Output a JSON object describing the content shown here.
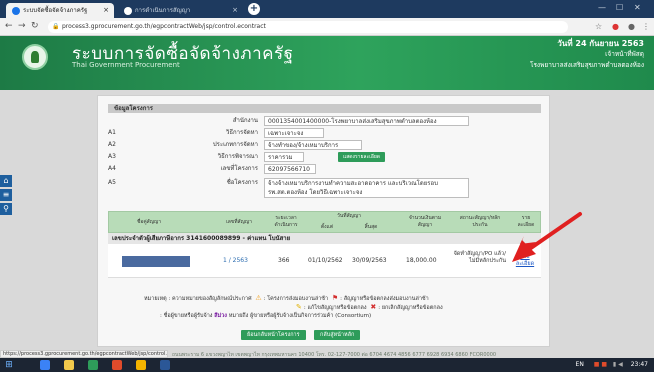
{
  "browser": {
    "tabs": [
      {
        "label": "ระบบจัดซื้อจัดจ้างภาครัฐ"
      },
      {
        "label": "การดำเนินการสัญญา"
      }
    ],
    "url": "process3.gprocurement.go.th/egpcontractWeb/jsp/control.econtract",
    "status_url": "https://process3.gprocurement.go.th/egpcontractWeb/jsp/control.econtract#"
  },
  "header": {
    "title": "ระบบการจัดซื้อจัดจ้างภาครัฐ",
    "subtitle": "Thai Government Procurement",
    "date": "วันที่ 24 กันยายน 2563",
    "role": "เจ้าหน้าที่พัสดุ",
    "org": "โรงพยาบาลส่งเสริมสุขภาพตำบลตองห้อง"
  },
  "side_icons": [
    "home-icon",
    "menu-icon",
    "search-icon"
  ],
  "project": {
    "section_title": "ข้อมูลโครงการ",
    "rows": [
      {
        "code": "",
        "label": "สำนักงาน",
        "value": "0001354001400000-โรงพยาบาลส่งเสริมสุขภาพตำบลตองห้อง"
      },
      {
        "code": "A1",
        "label": "วิธีการจัดหา",
        "value": "เฉพาะเจาะจง"
      },
      {
        "code": "A2",
        "label": "ประเภทการจัดหา",
        "value": "จ้างทำของ/จ้างเหมาบริการ"
      },
      {
        "code": "A3",
        "label": "วิธีการพิจารณา",
        "value": "ราคารวม"
      },
      {
        "code": "A4",
        "label": "เลขที่โครงการ",
        "value": "62097566710"
      },
      {
        "code": "A5",
        "label": "ชื่อโครงการ",
        "value": "จ้างจ้างเหมาบริการงานทำความสะอาดอาคาร และบริเวณโดยรอบ รพ.สต.ตองห้อง โดยวิธีเฉพาะเจาะจง"
      }
    ],
    "detail_button": "แสดงรายละเอียด"
  },
  "contracts_table": {
    "headers": {
      "contract_name": "ชื่อคู่สัญญา",
      "contract_no": "เลขที่สัญญา",
      "duration": "ระยะเวลาดำเนินการ",
      "contract_date": "วันที่สัญญา",
      "start": "ตั้งแต่",
      "end": "สิ้นสุด",
      "amount": "จำนวนเงินตามสัญญา",
      "status": "สถานะสัญญา/หลักประกัน",
      "action": "ราย ละเอียด"
    },
    "group_title": "เลขประจำตัวผู้เสียภาษีอากร 3141600089899 - ค่าแทน โบนัสาย",
    "rows": [
      {
        "contract_no": "1 / 2563",
        "duration": "366",
        "start": "01/10/2562",
        "end": "30/09/2563",
        "amount": "18,000.00",
        "status": "จัดทำสัญญา/PO แล้ว/ไม่มีหลักประกัน",
        "detail_link": "รายละเอียด"
      }
    ]
  },
  "legend": {
    "prefix": "หมายเหตุ : ความหมายของสัญลักษณ์ประกาศ",
    "warn": ": โครงการส่งมอบงานล่าช้า",
    "flag": ": สัญญาหรือข้อตกลงส่งมอบงานล่าช้า",
    "pencil": ": แก้ไขสัญญาหรือข้อตกลง",
    "cancel": ": ยกเลิกสัญญาหรือข้อตกลง",
    "consortium_a": ": ชื่อผู้ขายหรือผู้รับจ้าง",
    "consortium_b": "สีม่วง",
    "consortium_c": "หมายถึง ผู้ขายหรือผู้รับจ้างเป็นกิจการร่วมค้า (Consortium)"
  },
  "buttons": {
    "back_project": "ย้อนกลับหน้าโครงการ",
    "back_contract": "กลับสู่หน้าหลัก"
  },
  "footer_text": "ถนนพระราม 6 แขวงพญาไท เขตพญาไท กรุงเทพมหานคร 10400 โทร. 02-127-7000 ต่อ 6704 4674 4856 6777 6928 6934 6860 FCOR0000",
  "taskbar": {
    "lang": "EN",
    "time": "23:47"
  },
  "colors": {
    "header_green": "#2e8b57",
    "button_green": "#2e9c5a",
    "table_head": "#b8dcb8",
    "arrow_red": "#e02020"
  }
}
